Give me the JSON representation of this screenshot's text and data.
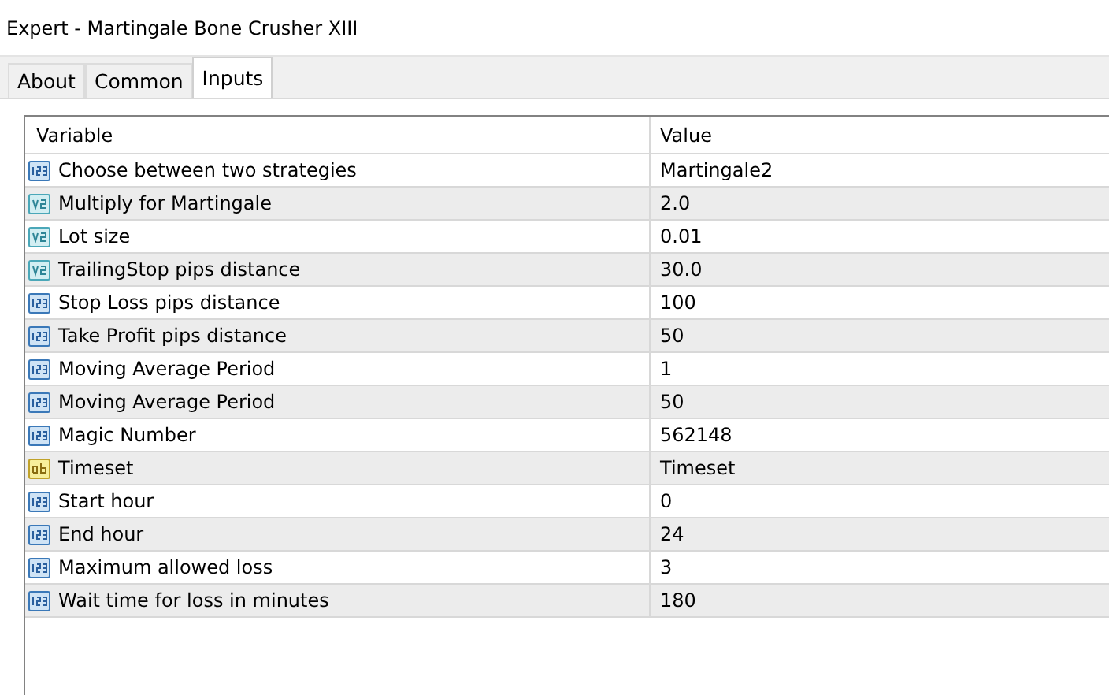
{
  "window": {
    "title": "Expert - Martingale Bone Crusher XIII"
  },
  "tabs": [
    {
      "label": "About",
      "selected": false
    },
    {
      "label": "Common",
      "selected": false
    },
    {
      "label": "Inputs",
      "selected": true
    }
  ],
  "table": {
    "columns": [
      "Variable",
      "Value"
    ],
    "rows": [
      {
        "kind": "int",
        "variable": "Choose between two strategies",
        "value": "Martingale2"
      },
      {
        "kind": "double",
        "variable": "Multiply for Martingale",
        "value": "2.0"
      },
      {
        "kind": "double",
        "variable": "Lot size",
        "value": "0.01"
      },
      {
        "kind": "double",
        "variable": "TrailingStop pips distance",
        "value": "30.0"
      },
      {
        "kind": "int",
        "variable": "Stop Loss pips distance",
        "value": "100"
      },
      {
        "kind": "int",
        "variable": "Take Profit pips distance",
        "value": "50"
      },
      {
        "kind": "int",
        "variable": "Moving Average Period",
        "value": "1"
      },
      {
        "kind": "int",
        "variable": "Moving Average Period",
        "value": "50"
      },
      {
        "kind": "int",
        "variable": "Magic Number",
        "value": "562148"
      },
      {
        "kind": "string",
        "variable": "Timeset",
        "value": "Timeset"
      },
      {
        "kind": "int",
        "variable": "Start hour",
        "value": "0"
      },
      {
        "kind": "int",
        "variable": "End hour",
        "value": "24"
      },
      {
        "kind": "int",
        "variable": "Maximum allowed loss",
        "value": "3"
      },
      {
        "kind": "int",
        "variable": "Wait time for loss in minutes",
        "value": "180"
      }
    ]
  }
}
